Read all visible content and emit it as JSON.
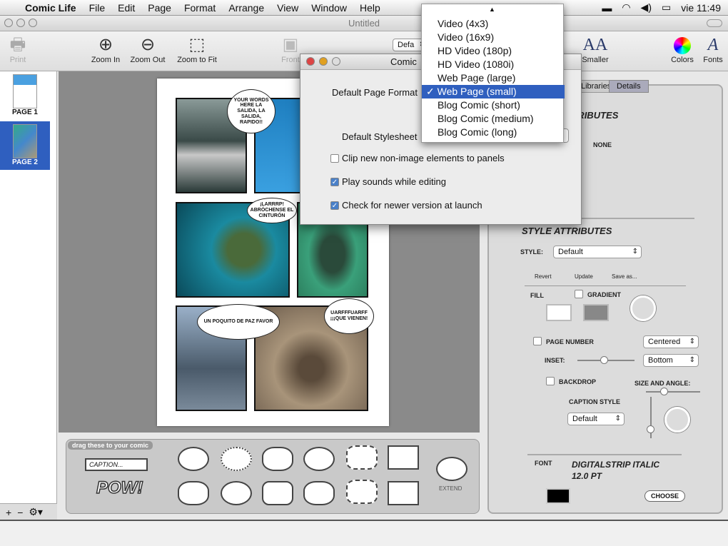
{
  "menubar": {
    "app": "Comic Life",
    "items": [
      "File",
      "Edit",
      "Page",
      "Format",
      "Arrange",
      "View",
      "Window",
      "Help"
    ],
    "clock": "vie 11:49"
  },
  "window": {
    "title": "Untitled"
  },
  "toolbar": {
    "print": "Print",
    "zoom_in": "Zoom In",
    "zoom_out": "Zoom Out",
    "zoom_fit": "Zoom to Fit",
    "front": "Front",
    "style_select": "Defa",
    "smaller": "Smaller",
    "colors": "Colors",
    "fonts": "Fonts"
  },
  "sidebar": {
    "pages": [
      "PAGE 1",
      "PAGE 2"
    ]
  },
  "comic": {
    "bubbles": [
      "YOUR WORDS HERE LA SALIDA, LA SALIDA, RAPIDO!!",
      "¡LARRRP! ABRÓCHENSE EL CINTURÓN",
      "UN POQUITO DE PAZ FAVOR",
      "UARFFFUARFF ¡¡¡QUE VIENEN!"
    ]
  },
  "palette": {
    "title": "drag these to your comic",
    "caption": "CAPTION...",
    "pow": "POW!",
    "extend": "EXTEND"
  },
  "dialog": {
    "title": "Comic Life Preferences",
    "page_format_label": "Default Page Format",
    "stylesheet_label": "Default Stylesheet",
    "checks": [
      {
        "label": "Clip new non-image elements to panels",
        "checked": false
      },
      {
        "label": "Play sounds while editing",
        "checked": true
      },
      {
        "label": "Check for newer version at launch",
        "checked": true
      }
    ]
  },
  "popup": {
    "items": [
      "Video (4x3)",
      "Video (16x9)",
      "HD Video (180p)",
      "HD Video (1080i)",
      "Web Page (large)",
      "Web Page (small)",
      "Blog Comic (short)",
      "Blog Comic (medium)",
      "Blog Comic (long)"
    ],
    "selected": 5
  },
  "inspector": {
    "tabs": [
      "Libraries",
      "Details"
    ],
    "attributes_heading": "ATTRIBUTES",
    "none": "NONE",
    "style_heading": "STYLE ATTRIBUTES",
    "style_label": "STYLE:",
    "style_value": "Default",
    "revert": "Revert",
    "update": "Update",
    "save_as": "Save as...",
    "fill": "FILL",
    "gradient": "GRADIENT",
    "page_number": "PAGE NUMBER",
    "position_h": "Centered",
    "inset": "INSET:",
    "position_v": "Bottom",
    "backdrop": "BACKDROP",
    "size_angle": "SIZE AND ANGLE:",
    "caption_style": "CAPTION STYLE",
    "caption_value": "Default",
    "font_label": "FONT",
    "font_name": "DIGITALSTRIP ITALIC",
    "font_size": "12.0 PT",
    "choose": "CHOOSE"
  },
  "colors": {
    "selection": "#2f5fbf",
    "canvas": "#8a8a8a"
  }
}
